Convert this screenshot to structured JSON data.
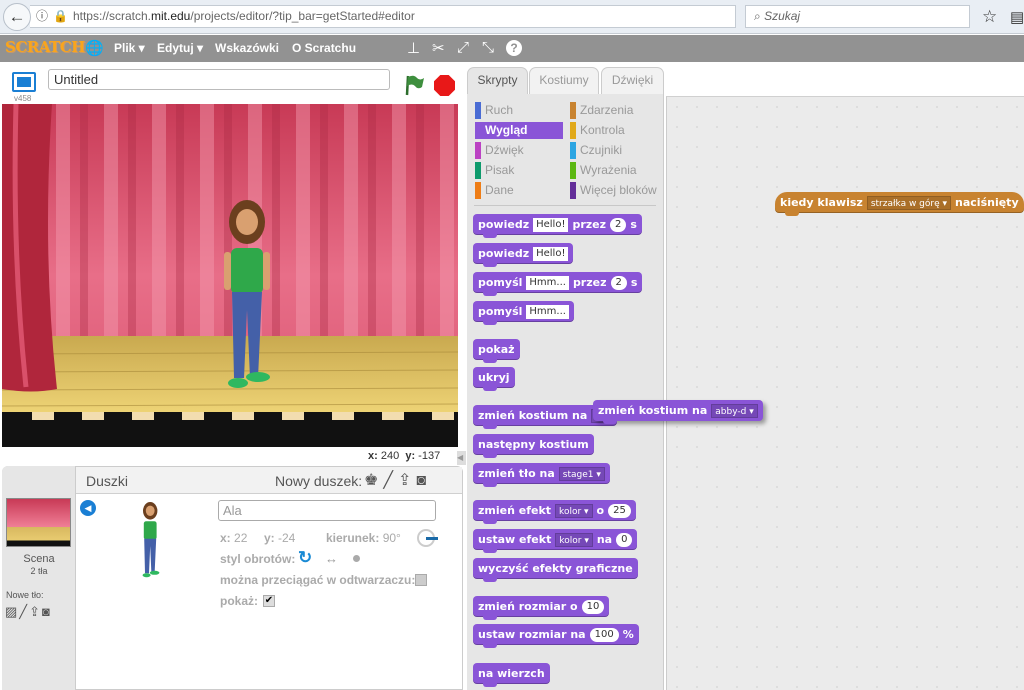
{
  "browser": {
    "url_prefix": "https://scratch.",
    "url_domain": "mit.edu",
    "url_path": "/projects/editor/?tip_bar=getStarted#editor",
    "search_placeholder": "Szukaj"
  },
  "menu": {
    "logo": "SCRATCH",
    "items": [
      "Plik ▾",
      "Edytuj ▾",
      "Wskazówki",
      "O Scratchu"
    ]
  },
  "stage_header": {
    "version": "v458",
    "project_title": "Untitled"
  },
  "stage": {
    "x_label": "x:",
    "x_value": "240",
    "y_label": "y:",
    "y_value": "-137"
  },
  "sprites_panel": {
    "title": "Duszki",
    "new_sprite_label": "Nowy duszek:",
    "stage_name": "Scena",
    "stage_backdrops": "2 tła",
    "new_backdrop_label": "Nowe tło:",
    "sprite_name": "Ala",
    "x_label": "x:",
    "x_value": "22",
    "y_label": "y:",
    "y_value": "-24",
    "direction_label": "kierunek:",
    "direction_value": "90°",
    "rotation_label": "styl obrotów:",
    "draggable_label": "można przeciągać w odtwarzaczu:",
    "draggable_checked": false,
    "show_label": "pokaż:",
    "show_checked": true
  },
  "tabs": [
    "Skrypty",
    "Kostiumy",
    "Dźwięki"
  ],
  "active_tab": 0,
  "categories": [
    {
      "label": "Ruch",
      "color": "#4a6cd4"
    },
    {
      "label": "Wygląd",
      "color": "#8a55d7",
      "selected": true
    },
    {
      "label": "Dźwięk",
      "color": "#bb42c3"
    },
    {
      "label": "Pisak",
      "color": "#0e9a6c"
    },
    {
      "label": "Dane",
      "color": "#ee7d16"
    },
    {
      "label": "Zdarzenia",
      "color": "#c88330"
    },
    {
      "label": "Kontrola",
      "color": "#e1a91a"
    },
    {
      "label": "Czujniki",
      "color": "#2ca5e2"
    },
    {
      "label": "Wyrażenia",
      "color": "#5cb712"
    },
    {
      "label": "Więcej bloków",
      "color": "#632d99"
    }
  ],
  "colors": {
    "looks": "#8a55d7",
    "events": "#c88330"
  },
  "palette_blocks": [
    [
      {
        "t": "powiedz"
      },
      {
        "i": "Hello!"
      },
      {
        "t": "przez"
      },
      {
        "n": "2"
      },
      {
        "t": "s"
      }
    ],
    [
      {
        "t": "powiedz"
      },
      {
        "i": "Hello!"
      }
    ],
    [
      {
        "t": "pomyśl"
      },
      {
        "i": "Hmm..."
      },
      {
        "t": "przez"
      },
      {
        "n": "2"
      },
      {
        "t": "s"
      }
    ],
    [
      {
        "t": "pomyśl"
      },
      {
        "i": "Hmm..."
      }
    ],
    [
      {
        "t": "pokaż"
      }
    ],
    [
      {
        "t": "ukryj"
      }
    ],
    [
      {
        "t": "zmień kostium na"
      },
      {
        "d": "a"
      }
    ],
    [
      {
        "t": "następny kostium"
      }
    ],
    [
      {
        "t": "zmień tło na"
      },
      {
        "d": "stage1"
      }
    ],
    [
      {
        "t": "zmień efekt"
      },
      {
        "d": "kolor"
      },
      {
        "t": "o"
      },
      {
        "n": "25"
      }
    ],
    [
      {
        "t": "ustaw efekt"
      },
      {
        "d": "kolor"
      },
      {
        "t": "na"
      },
      {
        "n": "0"
      }
    ],
    [
      {
        "t": "wyczyść efekty graficzne"
      }
    ],
    [
      {
        "t": "zmień rozmiar o"
      },
      {
        "n": "10"
      }
    ],
    [
      {
        "t": "ustaw rozmiar na"
      },
      {
        "n": "100"
      },
      {
        "t": "%"
      }
    ],
    [
      {
        "t": "na wierzch"
      }
    ]
  ],
  "dragged_block": [
    {
      "t": "zmień kostium na"
    },
    {
      "d": "abby-d"
    }
  ],
  "script_blocks": [
    [
      {
        "t": "kiedy klawisz"
      },
      {
        "d": "strzałka w górę"
      },
      {
        "t": "naciśnięty"
      }
    ]
  ]
}
